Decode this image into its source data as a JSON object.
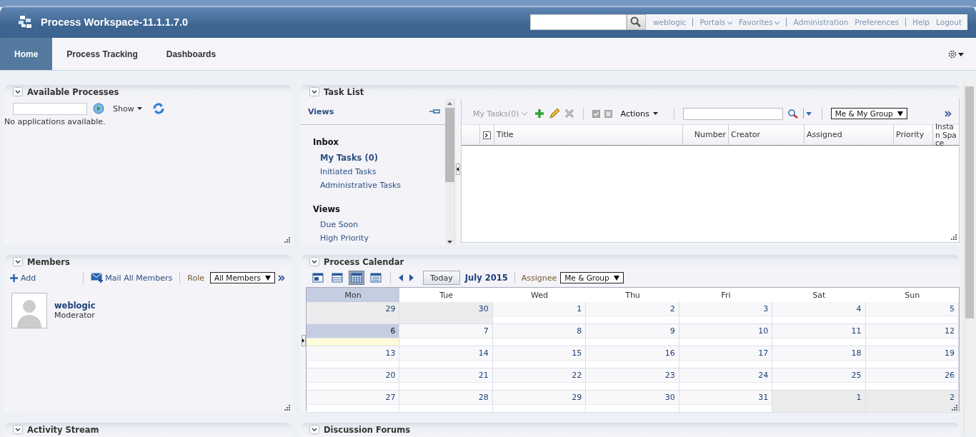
{
  "header": {
    "title": "Process Workspace-11.1.1.7.0",
    "link_groups": [
      [
        {
          "label": "weblogic",
          "has_menu": false
        }
      ],
      [
        {
          "label": "Portals",
          "has_menu": true
        },
        {
          "label": "Favorites",
          "has_menu": true
        }
      ],
      [
        {
          "label": "Administration",
          "has_menu": false
        },
        {
          "label": "Preferences",
          "has_menu": false
        }
      ],
      [
        {
          "label": "Help",
          "has_menu": false
        },
        {
          "label": "Logout",
          "has_menu": false
        }
      ]
    ]
  },
  "tabs": [
    {
      "label": "Home",
      "selected": true
    },
    {
      "label": "Process Tracking",
      "selected": false
    },
    {
      "label": "Dashboards",
      "selected": false
    }
  ],
  "available_processes": {
    "title": "Available Processes",
    "show": "Show",
    "message": "No applications available."
  },
  "task_list": {
    "title": "Task List",
    "views_title": "Views",
    "sections": [
      {
        "heading": "Inbox",
        "items": [
          {
            "label": "My Tasks (0)",
            "selected": true
          },
          {
            "label": "Initiated Tasks",
            "selected": false
          },
          {
            "label": "Administrative Tasks",
            "selected": false
          }
        ]
      },
      {
        "heading": "Views",
        "items": [
          {
            "label": "Due Soon",
            "selected": false
          },
          {
            "label": "High Priority",
            "selected": false
          }
        ]
      }
    ],
    "my_tasks": "My Tasks(0)",
    "actions": "Actions",
    "filter": "Me & My Group",
    "columns": [
      "Title",
      "Number",
      "Creator",
      "Assigned",
      "Priority",
      "Instan Space"
    ]
  },
  "members": {
    "title": "Members",
    "add": "Add",
    "mail": "Mail All Members",
    "role_label": "Role",
    "role_value": "All Members",
    "list": [
      {
        "name": "weblogic",
        "role": "Moderator"
      }
    ]
  },
  "calendar": {
    "title": "Process Calendar",
    "views": [
      {
        "kind": "day",
        "selected": false
      },
      {
        "kind": "week",
        "selected": false
      },
      {
        "kind": "month",
        "selected": true
      },
      {
        "kind": "list",
        "selected": false
      }
    ],
    "today": "Today",
    "month": "July 2015",
    "assignee_label": "Assignee",
    "assignee_value": "Me & Group",
    "days": [
      {
        "label": "Mon",
        "selected": true
      },
      {
        "label": "Tue",
        "selected": false
      },
      {
        "label": "Wed",
        "selected": false
      },
      {
        "label": "Thu",
        "selected": false
      },
      {
        "label": "Fri",
        "selected": false
      },
      {
        "label": "Sat",
        "selected": false
      },
      {
        "label": "Sun",
        "selected": false
      }
    ],
    "weeks": [
      [
        {
          "date": "29",
          "other_month": true,
          "selected": false
        },
        {
          "date": "30",
          "other_month": true,
          "selected": false
        },
        {
          "date": "1",
          "other_month": false,
          "selected": false
        },
        {
          "date": "2",
          "other_month": false,
          "selected": false
        },
        {
          "date": "3",
          "other_month": false,
          "selected": false
        },
        {
          "date": "4",
          "other_month": false,
          "selected": false
        },
        {
          "date": "5",
          "other_month": false,
          "selected": false
        }
      ],
      [
        {
          "date": "6",
          "other_month": false,
          "selected": true
        },
        {
          "date": "7",
          "other_month": false,
          "selected": false
        },
        {
          "date": "8",
          "other_month": false,
          "selected": false
        },
        {
          "date": "9",
          "other_month": false,
          "selected": false
        },
        {
          "date": "10",
          "other_month": false,
          "selected": false
        },
        {
          "date": "11",
          "other_month": false,
          "selected": false
        },
        {
          "date": "12",
          "other_month": false,
          "selected": false
        }
      ],
      [
        {
          "date": "13",
          "other_month": false,
          "selected": false
        },
        {
          "date": "14",
          "other_month": false,
          "selected": false
        },
        {
          "date": "15",
          "other_month": false,
          "selected": false
        },
        {
          "date": "16",
          "other_month": false,
          "selected": false
        },
        {
          "date": "17",
          "other_month": false,
          "selected": false
        },
        {
          "date": "18",
          "other_month": false,
          "selected": false
        },
        {
          "date": "19",
          "other_month": false,
          "selected": false
        }
      ],
      [
        {
          "date": "20",
          "other_month": false,
          "selected": false
        },
        {
          "date": "21",
          "other_month": false,
          "selected": false
        },
        {
          "date": "22",
          "other_month": false,
          "selected": false
        },
        {
          "date": "23",
          "other_month": false,
          "selected": false
        },
        {
          "date": "24",
          "other_month": false,
          "selected": false
        },
        {
          "date": "25",
          "other_month": false,
          "selected": false
        },
        {
          "date": "26",
          "other_month": false,
          "selected": false
        }
      ],
      [
        {
          "date": "27",
          "other_month": false,
          "selected": false
        },
        {
          "date": "28",
          "other_month": false,
          "selected": false
        },
        {
          "date": "29",
          "other_month": false,
          "selected": false
        },
        {
          "date": "30",
          "other_month": false,
          "selected": false
        },
        {
          "date": "31",
          "other_month": false,
          "selected": false
        },
        {
          "date": "1",
          "other_month": true,
          "selected": false
        },
        {
          "date": "2",
          "other_month": true,
          "selected": false
        }
      ]
    ]
  },
  "activity_stream": {
    "title": "Activity Stream"
  },
  "discussion_forums": {
    "title": "Discussion Forums"
  }
}
